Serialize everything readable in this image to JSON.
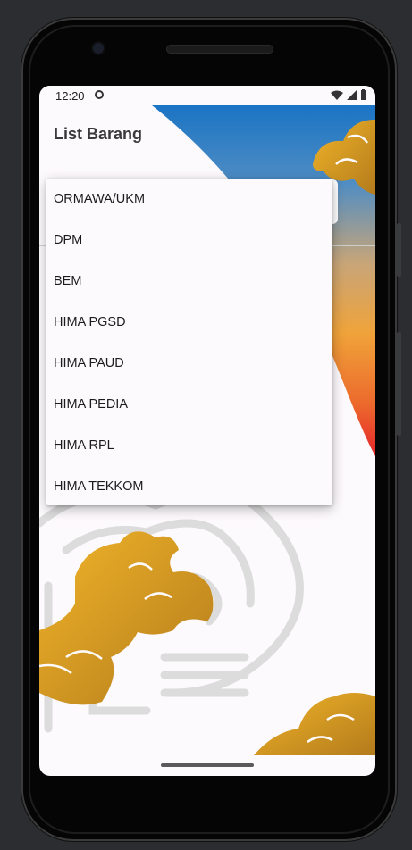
{
  "status_bar": {
    "time": "12:20"
  },
  "app": {
    "title": "List Barang"
  },
  "dropdown": {
    "options": [
      "ORMAWA/UKM",
      "DPM",
      "BEM",
      "HIMA PGSD",
      "HIMA PAUD",
      "HIMA PEDIA",
      "HIMA RPL",
      "HIMA TEKKOM"
    ]
  },
  "theme": {
    "arc_blue": "#1b74c4",
    "arc_orange": "#f0a33a",
    "arc_red": "#e6262b",
    "gold": "#d9a21f",
    "batik_gray": "#dcdcdc"
  }
}
